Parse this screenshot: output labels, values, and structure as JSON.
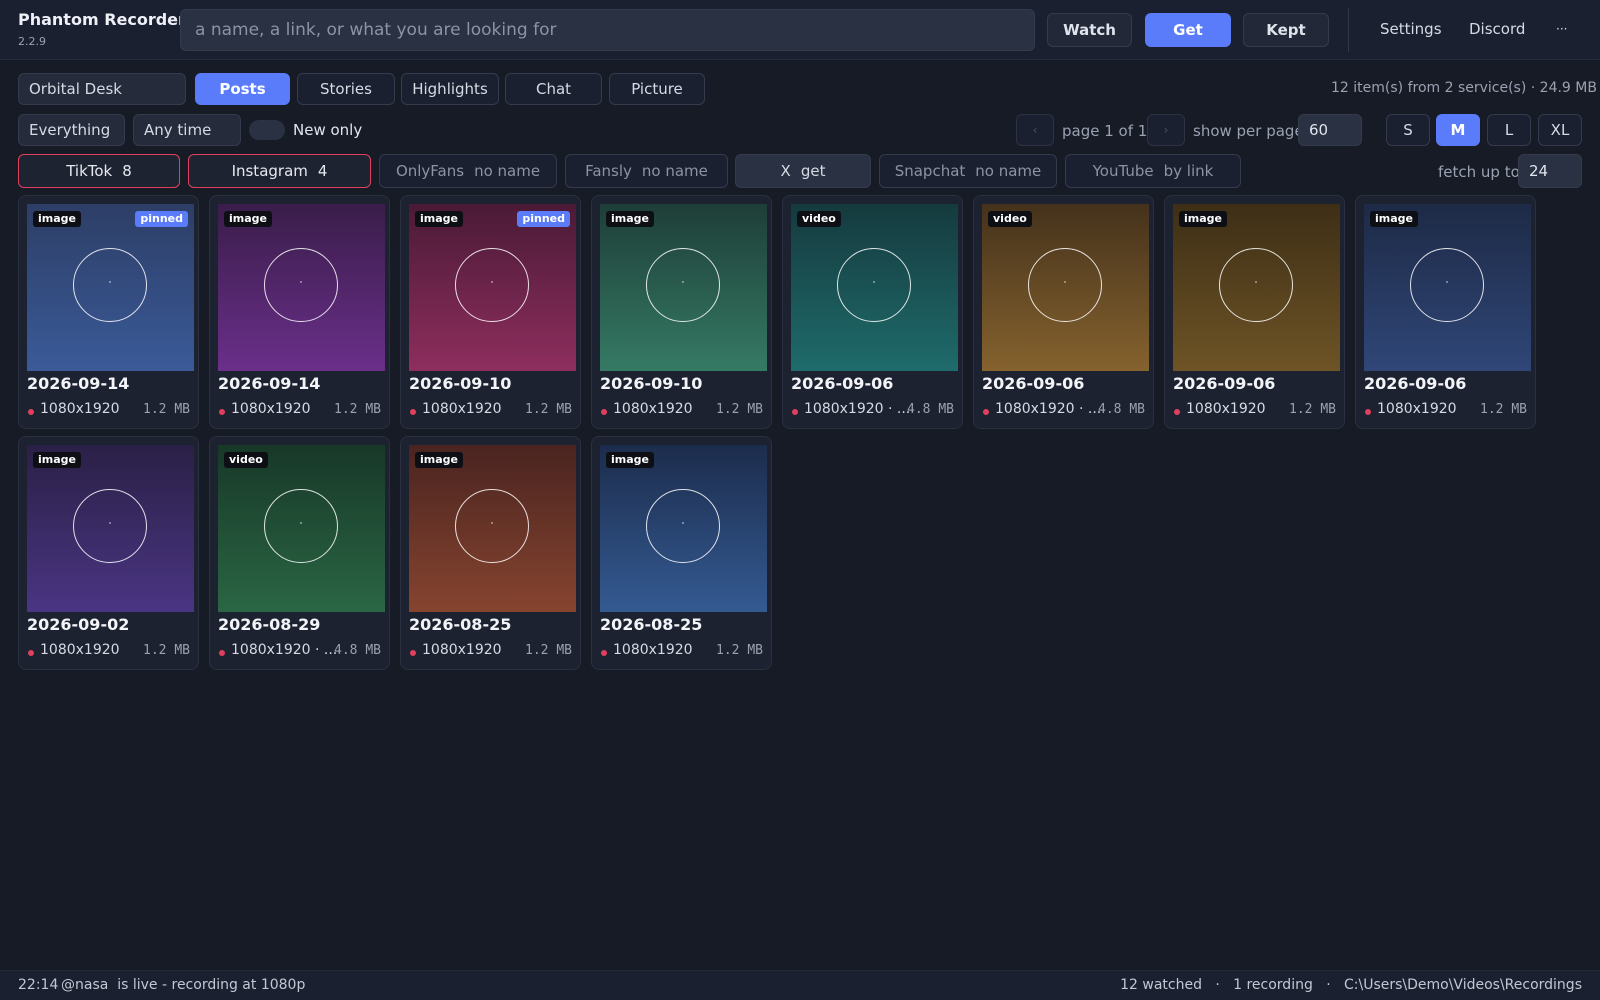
{
  "app": {
    "title": "Phantom Recorder",
    "version": "2.2.9"
  },
  "search": {
    "placeholder": "a name, a link, or what you are looking for"
  },
  "toolbar": {
    "watch": "Watch",
    "get": "Get",
    "kept": "Kept",
    "settings": "Settings",
    "discord": "Discord",
    "more": "···"
  },
  "profile": {
    "name": "Orbital Desk"
  },
  "content_tabs": [
    "Posts",
    "Stories",
    "Highlights",
    "Chat",
    "Picture"
  ],
  "active_tab": "Posts",
  "summary": "12 item(s) from 2 service(s)  ·  24.9 MB",
  "filters": {
    "type": "Everything",
    "time": "Any time",
    "new_only_label": "New only",
    "new_only": false
  },
  "pagination": {
    "prev": "‹",
    "next": "›",
    "label": "page 1 of 1",
    "per_page_label": "show per page",
    "per_page": "60"
  },
  "sizes": [
    "S",
    "M",
    "L",
    "XL"
  ],
  "active_size": "M",
  "services": [
    {
      "name": "TikTok",
      "status": "8"
    },
    {
      "name": "Instagram",
      "status": "4"
    },
    {
      "name": "OnlyFans",
      "status": "no name"
    },
    {
      "name": "Fansly",
      "status": "no name"
    },
    {
      "name": "X",
      "status": "get"
    },
    {
      "name": "Snapchat",
      "status": "no name"
    },
    {
      "name": "YouTube",
      "status": "by link"
    }
  ],
  "fetch": {
    "label": "fetch up to",
    "value": "24"
  },
  "items": [
    {
      "date": "2026-09-14",
      "type": "image",
      "pinned": "pinned",
      "res": "1080x1920",
      "size": "1.2 MB",
      "colors": [
        "#2d3e66",
        "#3a5a98"
      ]
    },
    {
      "date": "2026-09-14",
      "type": "image",
      "pinned": "",
      "res": "1080x1920",
      "size": "1.2 MB",
      "colors": [
        "#3a1d4a",
        "#6a2f8a"
      ]
    },
    {
      "date": "2026-09-10",
      "type": "image",
      "pinned": "pinned",
      "res": "1080x1920",
      "size": "1.2 MB",
      "colors": [
        "#4a1a36",
        "#8e2e5e"
      ]
    },
    {
      "date": "2026-09-10",
      "type": "image",
      "pinned": "",
      "res": "1080x1920",
      "size": "1.2 MB",
      "colors": [
        "#1e3e38",
        "#357a64"
      ]
    },
    {
      "date": "2026-09-06",
      "type": "video",
      "pinned": "",
      "res": "1080x1920 · ...",
      "size": "4.8 MB",
      "colors": [
        "#153a3e",
        "#1f6b6b"
      ]
    },
    {
      "date": "2026-09-06",
      "type": "video",
      "pinned": "",
      "res": "1080x1920 · ...",
      "size": "4.8 MB",
      "colors": [
        "#45321c",
        "#85622e"
      ]
    },
    {
      "date": "2026-09-06",
      "type": "image",
      "pinned": "",
      "res": "1080x1920",
      "size": "1.2 MB",
      "colors": [
        "#3d2e16",
        "#6e5426"
      ]
    },
    {
      "date": "2026-09-06",
      "type": "image",
      "pinned": "",
      "res": "1080x1920",
      "size": "1.2 MB",
      "colors": [
        "#1e2a46",
        "#2f4677"
      ]
    },
    {
      "date": "2026-09-02",
      "type": "image",
      "pinned": "",
      "res": "1080x1920",
      "size": "1.2 MB",
      "colors": [
        "#2a2046",
        "#4a3583"
      ]
    },
    {
      "date": "2026-08-29",
      "type": "video",
      "pinned": "",
      "res": "1080x1920 · ...",
      "size": "4.8 MB",
      "colors": [
        "#183828",
        "#2a6644"
      ]
    },
    {
      "date": "2026-08-25",
      "type": "image",
      "pinned": "",
      "res": "1080x1920",
      "size": "1.2 MB",
      "colors": [
        "#4a2420",
        "#86442f"
      ]
    },
    {
      "date": "2026-08-25",
      "type": "image",
      "pinned": "",
      "res": "1080x1920",
      "size": "1.2 MB",
      "colors": [
        "#1c2c4c",
        "#345a92"
      ]
    }
  ],
  "status": {
    "time": "22:14",
    "message": "@nasa  is live - recording at 1080p",
    "right": "12 watched   ·   1 recording   ·   C:\\Users\\Demo\\Videos\\Recordings"
  },
  "colors": {
    "accent": "#5b7cfa",
    "live": "#e0405e",
    "background": "#171b26"
  }
}
